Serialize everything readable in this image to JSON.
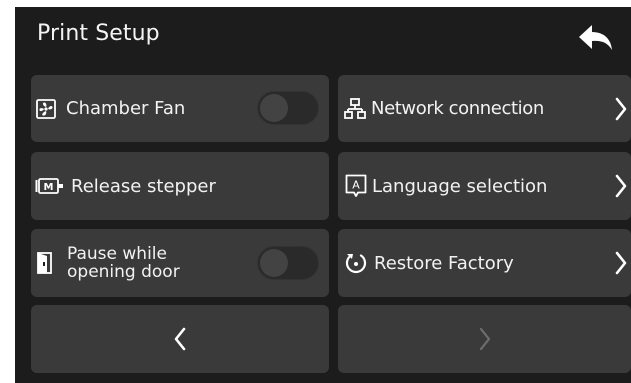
{
  "header": {
    "title": "Print Setup",
    "back_icon": "back-arrow-icon"
  },
  "left_column": {
    "chamber_fan": {
      "label": "Chamber Fan",
      "toggle_on": false,
      "icon": "fan-icon"
    },
    "release_stepper": {
      "label": "Release stepper",
      "icon": "motor-icon"
    },
    "pause_door": {
      "label": "Pause while opening door",
      "line1": "Pause while",
      "line2": "opening door",
      "toggle_on": false,
      "icon": "door-icon"
    }
  },
  "right_column": {
    "network": {
      "label": "Network connection",
      "icon": "network-icon"
    },
    "language": {
      "label": "Language selection",
      "icon": "language-icon"
    },
    "restore": {
      "label": "Restore Factory",
      "icon": "restore-icon"
    }
  },
  "pager": {
    "prev_icon": "chevron-left-icon",
    "next_icon": "chevron-right-icon",
    "next_enabled": false
  },
  "colors": {
    "screen_bg": "#1c1c1c",
    "tile_bg": "#3a3a3a",
    "text": "#f2f2f2",
    "disabled": "#7a7a7a"
  }
}
